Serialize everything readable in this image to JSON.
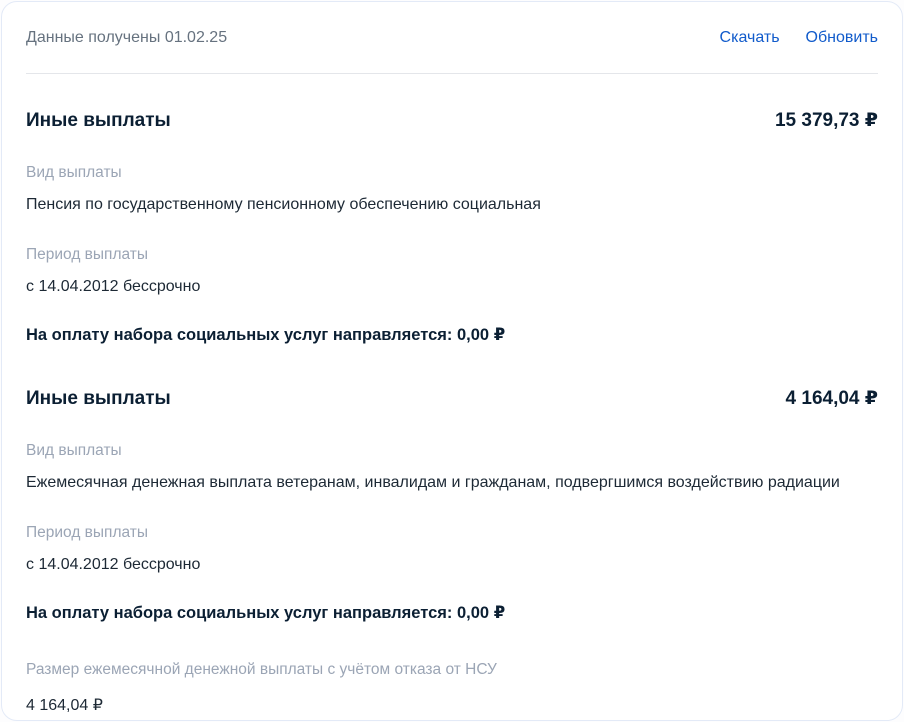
{
  "header": {
    "received": "Данные получены 01.02.25",
    "download_label": "Скачать",
    "refresh_label": "Обновить"
  },
  "colors": {
    "link_blue": "#115bcb",
    "text_dark": "#0b1f33",
    "label_gray": "#9ba5b5",
    "muted_gray": "#66727f",
    "divider_gray": "#e4e6ea",
    "card_border": "#e3eaf7"
  },
  "sections": [
    {
      "title": "Иные выплаты",
      "amount": "15 379,73 ₽",
      "fields": [
        {
          "label": "Вид выплаты",
          "value": "Пенсия по государственному пенсионному обеспечению социальная"
        },
        {
          "label": "Период выплаты",
          "value": "с 14.04.2012 бессрочно"
        }
      ],
      "nsu_line": "На оплату набора социальных услуг направляется: 0,00 ₽"
    },
    {
      "title": "Иные выплаты",
      "amount": "4 164,04 ₽",
      "fields": [
        {
          "label": "Вид выплаты",
          "value": "Ежемесячная денежная выплата ветеранам, инвалидам и гражданам, подвергшимся воздействию радиации"
        },
        {
          "label": "Период выплаты",
          "value": "с 14.04.2012 бессрочно"
        }
      ],
      "nsu_line": "На оплату набора социальных услуг направляется: 0,00 ₽",
      "extra_field": {
        "label": "Размер ежемесячной денежной выплаты с учётом отказа от НСУ",
        "value": "4 164,04 ₽"
      }
    }
  ]
}
